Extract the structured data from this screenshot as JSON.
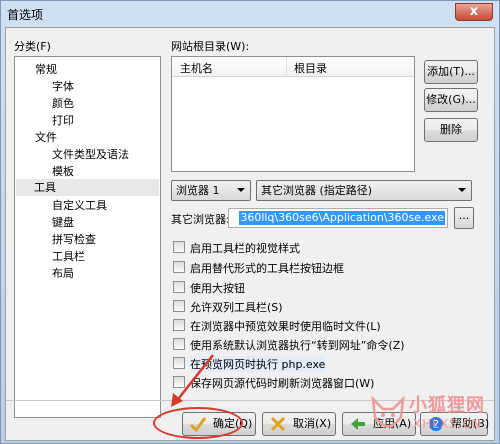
{
  "window": {
    "title": "首选项",
    "close_label": "x"
  },
  "category": {
    "label": "分类(F)",
    "items": [
      {
        "label": "常规",
        "level": 0
      },
      {
        "label": "字体",
        "level": 1
      },
      {
        "label": "颜色",
        "level": 1
      },
      {
        "label": "打印",
        "level": 1
      },
      {
        "label": "文件",
        "level": 0
      },
      {
        "label": "文件类型及语法",
        "level": 1
      },
      {
        "label": "模板",
        "level": 1
      },
      {
        "label": "工具",
        "level": 0,
        "selected": true
      },
      {
        "label": "自定义工具",
        "level": 1
      },
      {
        "label": "键盘",
        "level": 1
      },
      {
        "label": "拼写检查",
        "level": 1
      },
      {
        "label": "工具栏",
        "level": 1
      },
      {
        "label": "布局",
        "level": 1
      }
    ]
  },
  "webroot": {
    "label": "网站根目录(W):",
    "col_host": "主机名",
    "col_root": "根目录",
    "add_label": "添加(T)...",
    "edit_label": "修改(G)...",
    "delete_label": "删除"
  },
  "browser": {
    "select_value": "浏览器 1",
    "type_value": "其它浏览器 (指定路径)",
    "other_label": "其它浏览器:",
    "path_value": "360llq\\360se6\\Application\\360se.exe",
    "browse_label": "..."
  },
  "options": [
    {
      "label": "启用工具栏的视觉样式"
    },
    {
      "label": "启用替代形式的工具栏按钮边框"
    },
    {
      "label": "使用大按钮"
    },
    {
      "label": "允许双列工具栏(S)"
    },
    {
      "label": "在浏览器中预览效果时使用临时文件(L)"
    },
    {
      "label": "使用系统默认浏览器执行“转到网址”命令(Z)"
    },
    {
      "label": "在预览网页时执行 php.exe"
    },
    {
      "label": "保存网页源代码时刷新浏览器窗口(W)"
    }
  ],
  "buttons": {
    "ok_label": "确定(Q)",
    "cancel_label": "取消(X)",
    "apply_label": "应用(A)",
    "help_label": "帮助(B)"
  },
  "watermark": {
    "text": "小狐狸网",
    "sub": "XHLXS.CN"
  },
  "colors": {
    "selection": "#3399ff",
    "annotation": "#d93a2b",
    "watermark": "#ef9a9a"
  }
}
